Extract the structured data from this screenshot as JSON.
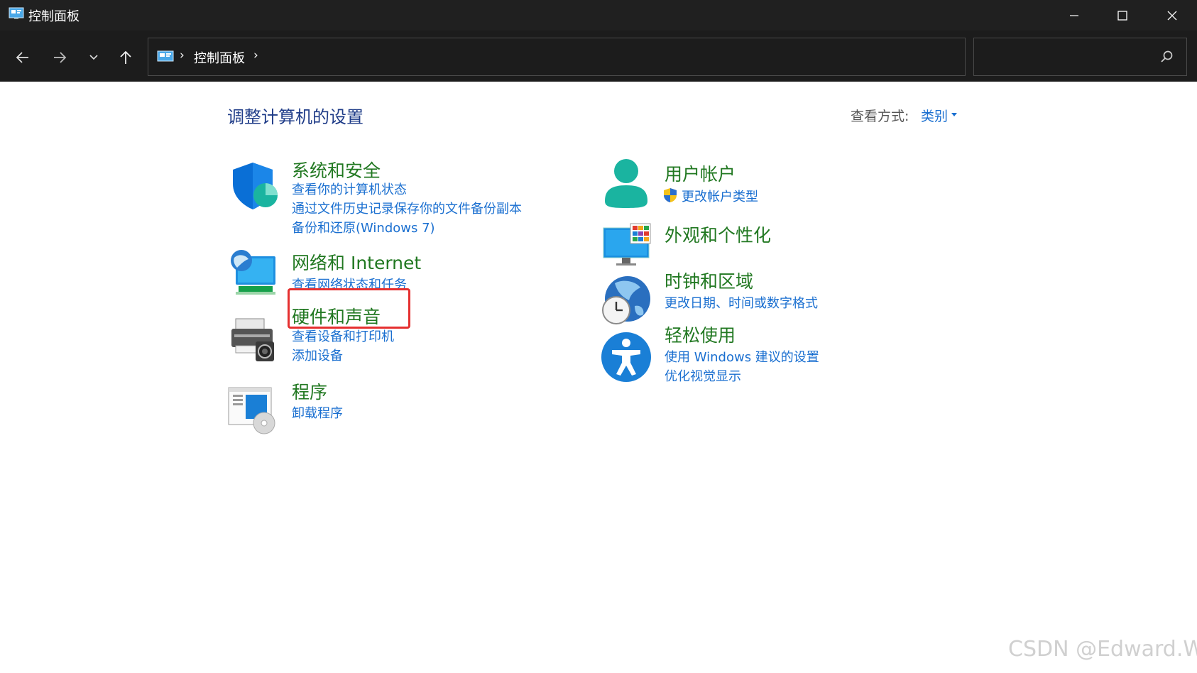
{
  "window": {
    "title": "控制面板",
    "controls": {
      "minimize": "minimize-icon",
      "maximize": "maximize-icon",
      "close": "close-icon"
    }
  },
  "navbar": {
    "breadcrumb": [
      "控制面板"
    ],
    "search": {
      "value": "",
      "placeholder": ""
    }
  },
  "content": {
    "page_title": "调整计算机的设置",
    "view_by": {
      "label": "查看方式:",
      "value": "类别"
    },
    "left_categories": [
      {
        "title": "系统和安全",
        "icon": "shield-icon",
        "links": [
          "查看你的计算机状态",
          "通过文件历史记录保存你的文件备份副本",
          "备份和还原(Windows 7)"
        ]
      },
      {
        "title": "网络和 Internet",
        "icon": "network-icon",
        "links": [
          "查看网络状态和任务"
        ]
      },
      {
        "title": "硬件和声音",
        "icon": "printer-icon",
        "links": [
          "查看设备和打印机",
          "添加设备"
        ]
      },
      {
        "title": "程序",
        "icon": "programs-icon",
        "links": [
          "卸载程序"
        ]
      }
    ],
    "right_categories": [
      {
        "title": "用户帐户",
        "icon": "user-icon",
        "links": [
          "更改帐户类型"
        ]
      },
      {
        "title": "外观和个性化",
        "icon": "monitor-icon",
        "links": []
      },
      {
        "title": "时钟和区域",
        "icon": "globe-clock-icon",
        "links": [
          "更改日期、时间或数字格式"
        ]
      },
      {
        "title": "轻松使用",
        "icon": "accessibility-icon",
        "links": [
          "使用 Windows 建议的设置",
          "优化视觉显示"
        ]
      }
    ]
  },
  "colors": {
    "title_bar": "#202020",
    "nav_bar": "#1c1c1c",
    "category_title": "#217821",
    "link": "#1a6fd0",
    "highlight": "#e53030"
  },
  "watermark": "CSDN @Edward.W"
}
